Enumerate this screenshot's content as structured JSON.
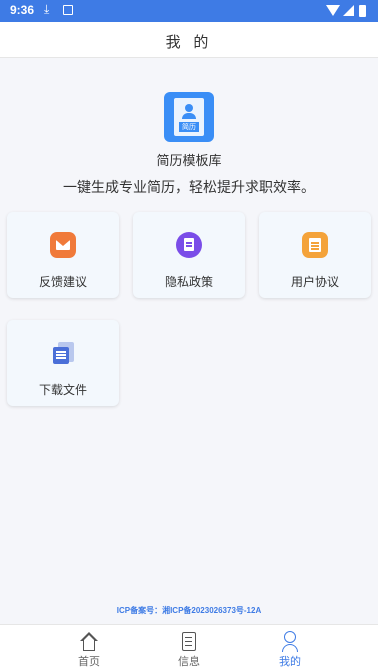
{
  "status_bar": {
    "time": "9:36"
  },
  "header": {
    "title": "我 的"
  },
  "app": {
    "logo_tag": "简历",
    "name": "简历模板库",
    "slogan": "一键生成专业简历，轻松提升求职效率。"
  },
  "menu": {
    "feedback": "反馈建议",
    "privacy": "隐私政策",
    "agreement": "用户协议",
    "download": "下载文件"
  },
  "footer": {
    "icp": "ICP备案号：湘ICP备2023026373号-12A"
  },
  "tabs": {
    "home": "首页",
    "info": "信息",
    "me": "我的"
  },
  "colors": {
    "accent": "#3e7be5",
    "feedback": "#f07a3a",
    "privacy": "#7a4de8",
    "agreement": "#f4a33a",
    "download": "#4a6fd8"
  }
}
